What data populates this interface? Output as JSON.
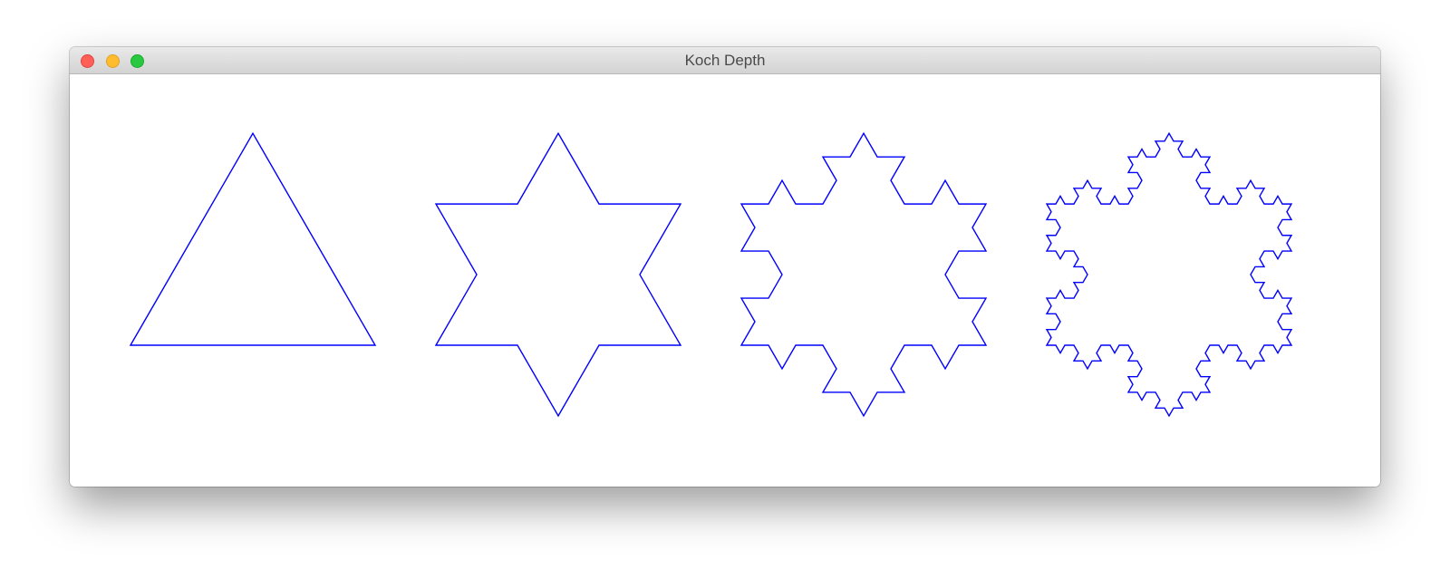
{
  "window": {
    "title": "Koch Depth",
    "controls": {
      "close": "close-button",
      "minimize": "minimize-button",
      "zoom": "zoom-button"
    }
  },
  "drawing": {
    "stroke_color": "#0000ff",
    "background": "#ffffff",
    "depths": [
      0,
      1,
      2,
      3
    ]
  }
}
